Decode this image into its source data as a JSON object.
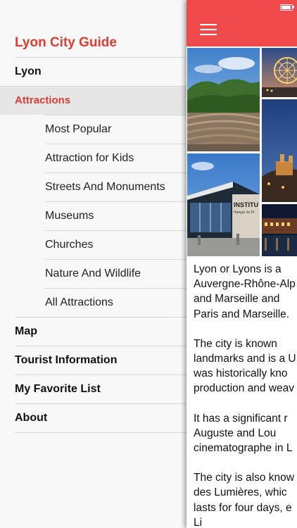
{
  "app": {
    "title": "Lyon City Guide"
  },
  "menu": {
    "items": [
      {
        "label": "Lyon",
        "kind": "top"
      },
      {
        "label": "Attractions",
        "kind": "section"
      },
      {
        "label": "Most Popular",
        "kind": "sub"
      },
      {
        "label": "Attraction for Kids",
        "kind": "sub"
      },
      {
        "label": "Streets And Monuments",
        "kind": "sub"
      },
      {
        "label": "Museums",
        "kind": "sub"
      },
      {
        "label": "Churches",
        "kind": "sub"
      },
      {
        "label": "Nature And Wildlife",
        "kind": "sub"
      },
      {
        "label": "All Attractions",
        "kind": "sub"
      },
      {
        "label": "Map",
        "kind": "top"
      },
      {
        "label": "Tourist Information",
        "kind": "top"
      },
      {
        "label": "My Favorite List",
        "kind": "top"
      },
      {
        "label": "About",
        "kind": "top"
      }
    ]
  },
  "header": {
    "icon": "hamburger-menu-icon",
    "status_icon": "battery-icon"
  },
  "collage": {
    "sign_text": "INSTITU",
    "sign_text_2": "Hangar du Pr"
  },
  "description": {
    "paragraphs": [
      "Lyon or Lyons is a\nAuvergne-Rhône-Alp\nand Marseille and\nParis and Marseille.",
      "The city is known\nlandmarks and is a U\nwas historically kno\nproduction and weav",
      "It has a significant r\nAuguste and Lou\ncinematographe in L",
      "The city is also know\ndes Lumières, whic\nlasts for four days, e\nLi"
    ]
  },
  "colors": {
    "accent": "#e03c31",
    "navbar": "#f0494c"
  }
}
